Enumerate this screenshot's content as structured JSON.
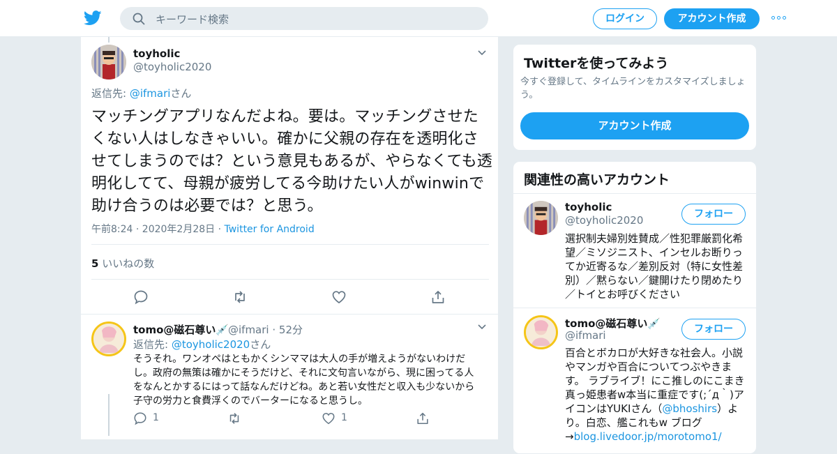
{
  "colors": {
    "accent": "#1da1f2",
    "link": "#1b95e0",
    "muted": "#657786",
    "text": "#14171a",
    "background": "#e6ecf0"
  },
  "header": {
    "logo_icon": "twitter-bird-icon",
    "search_placeholder": "キーワード検索",
    "login_label": "ログイン",
    "signup_label": "アカウント作成",
    "more_icon": "more-dots-icon"
  },
  "tweet": {
    "author_name": "toyholic",
    "author_handle": "@toyholic2020",
    "reply_prefix": "返信先: ",
    "reply_to": "@ifmari",
    "reply_suffix": "さん",
    "text": "マッチングアプリなんだよね。要は。マッチングさせたくない人はしなきゃいい。確かに父親の存在を透明化させてしまうのでは？という意見もあるが、やらなくても透明化してて、母親が疲労してる今助けたい人がwinwinで助け合うのは必要では？と思う。",
    "timestamp": "午前8:24 · 2020年2月28日 · ",
    "source": "Twitter for Android",
    "likes_count": "5",
    "likes_label": " いいねの数"
  },
  "reply": {
    "author_name": "tomo@磁石尊い",
    "author_emoji": "💉",
    "author_handle": "@ifmari",
    "time": " · 52分",
    "reply_prefix": "返信先: ",
    "reply_to": "@toyholic2020",
    "reply_suffix": "さん",
    "text": "そうそれ。ワンオペはともかくシンママは大人の手が増えようがないわけだし。政府の無策は確かにそうだけど、それに文句言いながら、現に困ってる人をなんとかするにはって話なんだけどね。あと若い女性だと収入も少ないから子守の労力と食費浮くのでバーターになると思うし。",
    "reply_count": "1",
    "like_count": "1"
  },
  "sidebar": {
    "signup_card": {
      "title": "Twitterを使ってみよう",
      "subtitle": "今すぐ登録して、タイムラインをカスタマイズしましょう。",
      "button": "アカウント作成"
    },
    "related": {
      "title": "関連性の高いアカウント",
      "follow_label": "フォロー",
      "accounts": [
        {
          "name": "toyholic",
          "handle": "@toyholic2020",
          "bio": "選択制夫婦別姓賛成／性犯罪厳罰化希望／ミソジニスト、インセルお断りってか近寄るな／差別反対（特に女性差別）／黙らない／鍵開けたり閉めたり／トイとお呼びください"
        },
        {
          "name": "tomo@磁石尊い",
          "emoji": "💉",
          "handle": "@ifmari",
          "bio_1": "百合とボカロが大好きな社会人。小説やマンガや百合についてつぶやきます。 ラブライブ！にこ推しのにこまき真っ姫患者w本当に重症です(;´д｀)アイコンはYUKIさん（",
          "bio_link": "@bhoshirs",
          "bio_2": "）より。白恋、艦これもw ブログ→",
          "bio_url": "blog.livedoor.jp/morotomo1/"
        }
      ]
    }
  }
}
